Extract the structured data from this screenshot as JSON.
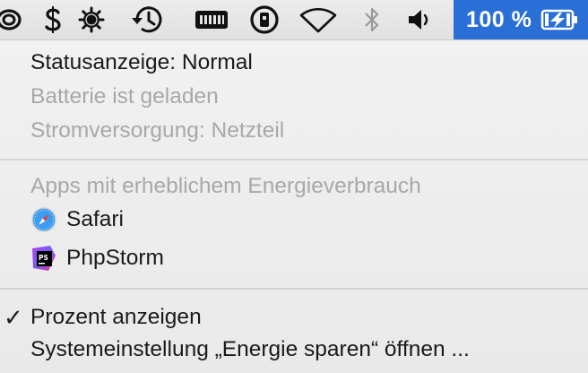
{
  "menubar": {
    "icons": [
      "creative-cloud-icon",
      "dollar-app-icon",
      "brightness-icon",
      "time-machine-icon",
      "memory-icon",
      "info-icon",
      "wifi-icon",
      "bluetooth-icon",
      "volume-icon"
    ],
    "battery_percent": "100 %",
    "accent_color": "#2a6fd6"
  },
  "menu": {
    "status_label": "Statusanzeige: Normal",
    "battery_charged": "Batterie ist geladen",
    "power_source": "Stromversorgung: Netzteil",
    "apps_heading": "Apps mit erheblichem Energieverbrauch",
    "apps": [
      {
        "name": "Safari",
        "icon": "safari-icon"
      },
      {
        "name": "PhpStorm",
        "icon": "phpstorm-icon"
      }
    ],
    "show_percent_check": "✓",
    "show_percent": "Prozent anzeigen",
    "open_energy_prefs": "Systemeinstellung „Energie sparen“ öffnen ..."
  }
}
